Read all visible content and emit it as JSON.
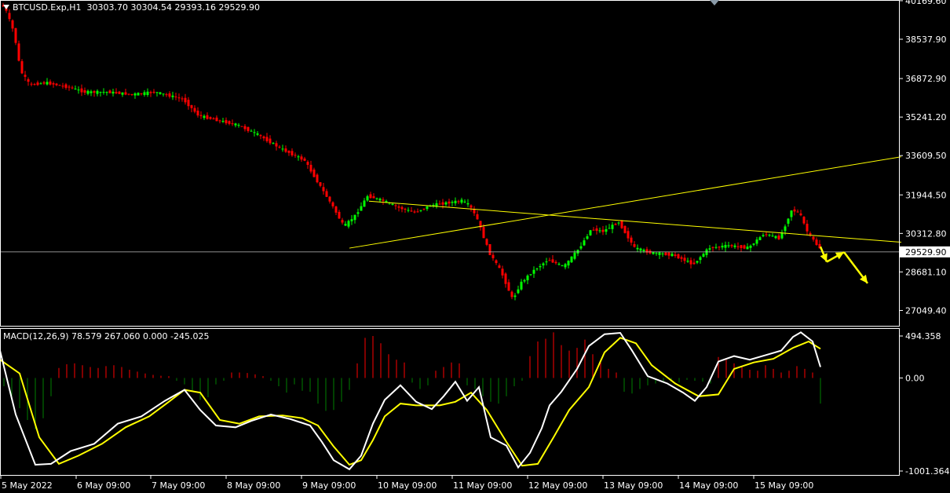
{
  "header": {
    "symbol_tf": "BTCUSD.Exp,H1",
    "ohlc": "30303.70 30304.54 29393.16 29529.90"
  },
  "macd_header": "MACD(12,26,9) 78.579 267.060 0.000 -245.025",
  "colors": {
    "background": "#000000",
    "grid_border": "#ffffff",
    "bull_candle": "#00ff00",
    "bear_candle": "#ff0000",
    "trendline": "#ffff00",
    "macd_line": "#ffffff",
    "signal_line": "#ffff00",
    "hist_pos": "#ff0000",
    "hist_neg": "#008000",
    "current_price_line": "#c0c0c0"
  },
  "chart_data": {
    "type": "line",
    "title": "BTCUSD.Exp,H1",
    "x_tick_labels": [
      "5 May 2022",
      "6 May 09:00",
      "7 May 09:00",
      "8 May 09:00",
      "9 May 09:00",
      "10 May 09:00",
      "11 May 09:00",
      "12 May 09:00",
      "13 May 09:00",
      "14 May 09:00",
      "15 May 09:00"
    ],
    "price_axis": {
      "ticks": [
        "40169.60",
        "38537.90",
        "36872.90",
        "35241.20",
        "33609.50",
        "31944.50",
        "30312.80",
        "28681.10",
        "27049.40"
      ],
      "range": [
        26400,
        40200
      ],
      "current_price": "29529.90"
    },
    "price_path": [
      [
        0,
        40000
      ],
      [
        8,
        39900
      ],
      [
        20,
        38800
      ],
      [
        28,
        37200
      ],
      [
        40,
        36600
      ],
      [
        60,
        36700
      ],
      [
        90,
        36500
      ],
      [
        110,
        36300
      ],
      [
        140,
        36300
      ],
      [
        170,
        36200
      ],
      [
        200,
        36300
      ],
      [
        235,
        36000
      ],
      [
        255,
        35300
      ],
      [
        280,
        35100
      ],
      [
        305,
        34900
      ],
      [
        330,
        34500
      ],
      [
        360,
        33900
      ],
      [
        390,
        33400
      ],
      [
        410,
        32300
      ],
      [
        425,
        31500
      ],
      [
        440,
        30600
      ],
      [
        455,
        31100
      ],
      [
        470,
        31900
      ],
      [
        490,
        31700
      ],
      [
        510,
        31400
      ],
      [
        530,
        31200
      ],
      [
        550,
        31500
      ],
      [
        570,
        31600
      ],
      [
        590,
        31700
      ],
      [
        600,
        31500
      ],
      [
        610,
        30900
      ],
      [
        625,
        29500
      ],
      [
        640,
        28700
      ],
      [
        655,
        27500
      ],
      [
        665,
        28200
      ],
      [
        680,
        28700
      ],
      [
        700,
        29200
      ],
      [
        720,
        28900
      ],
      [
        740,
        29700
      ],
      [
        755,
        30500
      ],
      [
        770,
        30400
      ],
      [
        790,
        30800
      ],
      [
        810,
        29700
      ],
      [
        830,
        29500
      ],
      [
        860,
        29400
      ],
      [
        885,
        29000
      ],
      [
        905,
        29700
      ],
      [
        930,
        29800
      ],
      [
        955,
        29700
      ],
      [
        975,
        30300
      ],
      [
        995,
        30100
      ],
      [
        1010,
        31300
      ],
      [
        1020,
        31200
      ],
      [
        1030,
        30400
      ],
      [
        1045,
        29700
      ]
    ],
    "trendlines": [
      {
        "from": [
          470,
          31680
        ],
        "to": [
          1148,
          29940
        ]
      },
      {
        "from": [
          445,
          29690
        ],
        "to": [
          1148,
          33560
        ]
      }
    ],
    "projection_arrows": [
      {
        "from": [
          1045,
          29750
        ],
        "to": [
          1053,
          29110
        ]
      },
      {
        "from": [
          1053,
          29110
        ],
        "to": [
          1075,
          29520
        ]
      },
      {
        "from": [
          1075,
          29520
        ],
        "to": [
          1105,
          28200
        ]
      }
    ],
    "macd_axis": {
      "ticks": [
        "494.358",
        "0.00",
        "-1001.364"
      ],
      "range": [
        -1001.364,
        494.358
      ]
    },
    "macd_line": [
      [
        0,
        300
      ],
      [
        20,
        -400
      ],
      [
        45,
        -950
      ],
      [
        65,
        -940
      ],
      [
        90,
        -800
      ],
      [
        120,
        -720
      ],
      [
        150,
        -500
      ],
      [
        180,
        -420
      ],
      [
        210,
        -250
      ],
      [
        235,
        -130
      ],
      [
        255,
        -350
      ],
      [
        275,
        -520
      ],
      [
        300,
        -540
      ],
      [
        320,
        -470
      ],
      [
        345,
        -400
      ],
      [
        370,
        -450
      ],
      [
        395,
        -520
      ],
      [
        410,
        -700
      ],
      [
        425,
        -900
      ],
      [
        445,
        -1000
      ],
      [
        460,
        -850
      ],
      [
        475,
        -500
      ],
      [
        490,
        -240
      ],
      [
        510,
        -80
      ],
      [
        530,
        -260
      ],
      [
        550,
        -340
      ],
      [
        565,
        -200
      ],
      [
        580,
        -40
      ],
      [
        595,
        -250
      ],
      [
        610,
        -100
      ],
      [
        625,
        -650
      ],
      [
        645,
        -740
      ],
      [
        660,
        -980
      ],
      [
        675,
        -820
      ],
      [
        690,
        -550
      ],
      [
        700,
        -300
      ],
      [
        715,
        -150
      ],
      [
        735,
        100
      ],
      [
        750,
        350
      ],
      [
        770,
        480
      ],
      [
        790,
        494
      ],
      [
        805,
        300
      ],
      [
        825,
        20
      ],
      [
        850,
        -60
      ],
      [
        870,
        -160
      ],
      [
        885,
        -250
      ],
      [
        900,
        -100
      ],
      [
        915,
        180
      ],
      [
        935,
        240
      ],
      [
        955,
        200
      ],
      [
        975,
        250
      ],
      [
        995,
        300
      ],
      [
        1010,
        450
      ],
      [
        1020,
        500
      ],
      [
        1035,
        400
      ],
      [
        1045,
        120
      ]
    ],
    "signal_line": [
      [
        0,
        200
      ],
      [
        25,
        50
      ],
      [
        50,
        -650
      ],
      [
        75,
        -940
      ],
      [
        100,
        -850
      ],
      [
        130,
        -720
      ],
      [
        160,
        -540
      ],
      [
        190,
        -420
      ],
      [
        215,
        -260
      ],
      [
        235,
        -130
      ],
      [
        255,
        -160
      ],
      [
        280,
        -460
      ],
      [
        305,
        -500
      ],
      [
        330,
        -420
      ],
      [
        360,
        -410
      ],
      [
        385,
        -440
      ],
      [
        405,
        -520
      ],
      [
        425,
        -750
      ],
      [
        445,
        -950
      ],
      [
        460,
        -900
      ],
      [
        475,
        -680
      ],
      [
        490,
        -420
      ],
      [
        510,
        -280
      ],
      [
        530,
        -300
      ],
      [
        560,
        -300
      ],
      [
        580,
        -260
      ],
      [
        600,
        -160
      ],
      [
        620,
        -350
      ],
      [
        645,
        -700
      ],
      [
        665,
        -960
      ],
      [
        685,
        -940
      ],
      [
        705,
        -650
      ],
      [
        725,
        -350
      ],
      [
        750,
        -100
      ],
      [
        770,
        280
      ],
      [
        790,
        440
      ],
      [
        810,
        380
      ],
      [
        830,
        140
      ],
      [
        860,
        -60
      ],
      [
        890,
        -200
      ],
      [
        915,
        -180
      ],
      [
        935,
        100
      ],
      [
        960,
        170
      ],
      [
        985,
        210
      ],
      [
        1010,
        330
      ],
      [
        1030,
        400
      ],
      [
        1045,
        320
      ]
    ],
    "histogram": [
      [
        5,
        -90
      ],
      [
        15,
        -210
      ],
      [
        25,
        -330
      ],
      [
        35,
        -460
      ],
      [
        45,
        -560
      ],
      [
        55,
        -440
      ],
      [
        65,
        -200
      ],
      [
        75,
        110
      ],
      [
        85,
        150
      ],
      [
        95,
        160
      ],
      [
        105,
        140
      ],
      [
        115,
        120
      ],
      [
        125,
        110
      ],
      [
        135,
        130
      ],
      [
        145,
        140
      ],
      [
        155,
        120
      ],
      [
        165,
        90
      ],
      [
        175,
        70
      ],
      [
        185,
        50
      ],
      [
        195,
        35
      ],
      [
        205,
        25
      ],
      [
        215,
        20
      ],
      [
        225,
        -30
      ],
      [
        235,
        -70
      ],
      [
        245,
        -150
      ],
      [
        255,
        -240
      ],
      [
        265,
        -210
      ],
      [
        275,
        -70
      ],
      [
        285,
        -30
      ],
      [
        295,
        60
      ],
      [
        305,
        60
      ],
      [
        315,
        55
      ],
      [
        325,
        40
      ],
      [
        335,
        20
      ],
      [
        345,
        -30
      ],
      [
        355,
        -90
      ],
      [
        365,
        -160
      ],
      [
        375,
        -70
      ],
      [
        385,
        -140
      ],
      [
        395,
        -150
      ],
      [
        405,
        -280
      ],
      [
        415,
        -360
      ],
      [
        425,
        -350
      ],
      [
        435,
        -260
      ],
      [
        445,
        -130
      ],
      [
        455,
        160
      ],
      [
        465,
        440
      ],
      [
        475,
        460
      ],
      [
        485,
        380
      ],
      [
        495,
        260
      ],
      [
        505,
        200
      ],
      [
        515,
        170
      ],
      [
        525,
        -50
      ],
      [
        535,
        -120
      ],
      [
        545,
        -80
      ],
      [
        555,
        80
      ],
      [
        565,
        120
      ],
      [
        575,
        170
      ],
      [
        585,
        160
      ],
      [
        595,
        -80
      ],
      [
        605,
        -120
      ],
      [
        615,
        -200
      ],
      [
        625,
        -260
      ],
      [
        635,
        -280
      ],
      [
        645,
        -200
      ],
      [
        655,
        -90
      ],
      [
        665,
        -30
      ],
      [
        675,
        240
      ],
      [
        685,
        400
      ],
      [
        695,
        430
      ],
      [
        705,
        500
      ],
      [
        715,
        360
      ],
      [
        725,
        300
      ],
      [
        735,
        330
      ],
      [
        745,
        420
      ],
      [
        755,
        260
      ],
      [
        765,
        180
      ],
      [
        775,
        100
      ],
      [
        785,
        60
      ],
      [
        795,
        -150
      ],
      [
        805,
        -170
      ],
      [
        815,
        -120
      ],
      [
        825,
        -80
      ],
      [
        835,
        -60
      ],
      [
        845,
        -40
      ],
      [
        855,
        -30
      ],
      [
        865,
        -50
      ],
      [
        875,
        -20
      ],
      [
        885,
        -30
      ],
      [
        895,
        -40
      ],
      [
        905,
        -60
      ],
      [
        915,
        230
      ],
      [
        925,
        200
      ],
      [
        935,
        160
      ],
      [
        945,
        120
      ],
      [
        955,
        90
      ],
      [
        965,
        80
      ],
      [
        975,
        140
      ],
      [
        985,
        100
      ],
      [
        995,
        60
      ],
      [
        1005,
        80
      ],
      [
        1015,
        130
      ],
      [
        1025,
        100
      ],
      [
        1035,
        60
      ],
      [
        1045,
        -280
      ]
    ]
  }
}
